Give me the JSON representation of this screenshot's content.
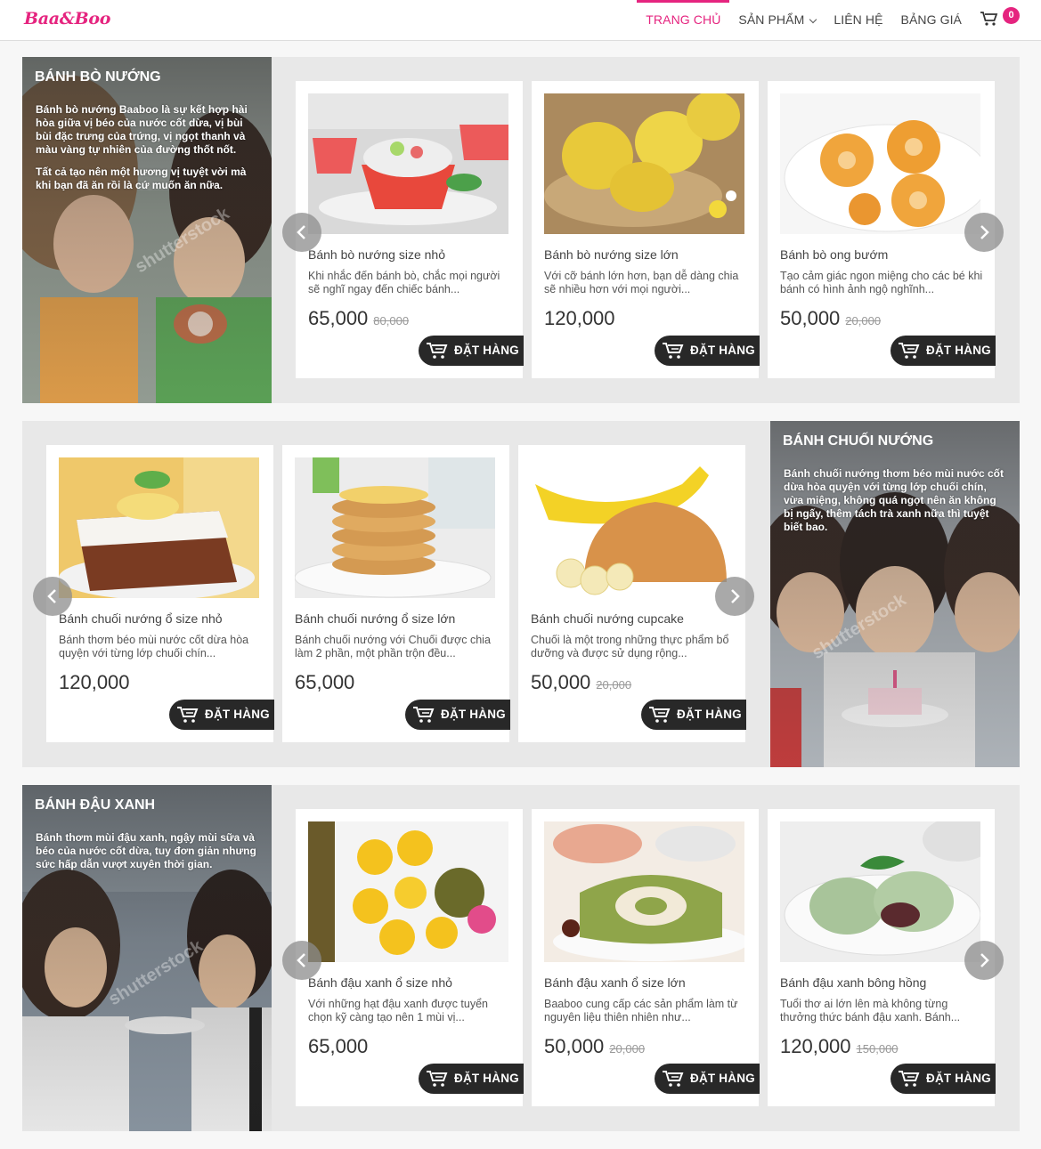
{
  "header": {
    "logo": "Baa&Boo",
    "nav": [
      {
        "label": "TRANG CHỦ",
        "active": true
      },
      {
        "label": "SẢN PHẨM",
        "dropdown": true
      },
      {
        "label": "LIÊN HỆ"
      },
      {
        "label": "BẢNG GIÁ"
      }
    ],
    "cart_count": "0",
    "accent_color": "#e5247f"
  },
  "order_label": "ĐẶT HÀNG",
  "sections": [
    {
      "title": "BÁNH BÒ NƯỚNG",
      "paragraphs": [
        "Bánh bò nướng Baaboo là sự kết hợp hài hòa giữa vị béo của nước cốt dừa, vị bùi bùi đặc trưng của trứng, vị ngọt thanh và màu vàng tự nhiên của đường thốt nốt.",
        "Tất cả tạo nên một hương vị tuyệt vời mà khi bạn đã ăn rồi là cứ muốn ăn nữa."
      ],
      "products": [
        {
          "name": "Bánh bò nướng size nhỏ",
          "desc": "Khi nhắc đến bánh bò, chắc mọi người sẽ nghĩ ngay đến chiếc bánh...",
          "price": "65,000",
          "old_price": "80,000"
        },
        {
          "name": "Bánh bò nướng size lớn",
          "desc": "Với cỡ bánh lớn hơn, bạn dễ dàng chia sẽ nhiều hơn với mọi người...",
          "price": "120,000",
          "old_price": ""
        },
        {
          "name": "Bánh bò ong bướm",
          "desc": "Tạo cảm giác ngon miệng cho các bé khi bánh có hình ảnh ngộ nghĩnh...",
          "price": "50,000",
          "old_price": "20,000"
        }
      ]
    },
    {
      "title": "BÁNH CHUỐI NƯỚNG",
      "paragraphs": [
        "Bánh chuối nướng thơm béo mùi nước cốt dừa hòa quyện với từng lớp chuối chín, vừa miệng, không quá ngọt nên ăn không bị ngấy, thêm tách trà xanh nữa thì tuyệt biết bao."
      ],
      "products": [
        {
          "name": "Bánh chuối nướng ổ size nhỏ",
          "desc": "Bánh thơm béo mùi nước cốt dừa hòa quyện với từng lớp chuối chín...",
          "price": "120,000",
          "old_price": ""
        },
        {
          "name": "Bánh chuối nướng ổ size lớn",
          "desc": "Bánh chuối nướng với Chuối được chia làm 2 phần, một phần trộn đều...",
          "price": "65,000",
          "old_price": ""
        },
        {
          "name": "Bánh chuối nướng cupcake",
          "desc": "Chuối là một trong những thực phẩm bổ dưỡng và được sử dụng rộng...",
          "price": "50,000",
          "old_price": "20,000"
        }
      ]
    },
    {
      "title": "BÁNH ĐẬU XANH",
      "paragraphs": [
        "Bánh thơm mùi đậu xanh, ngậy mùi sữa và béo của nước cốt dừa, tuy đơn giản nhưng sức hấp dẫn vượt xuyên thời gian."
      ],
      "products": [
        {
          "name": "Bánh đậu xanh ổ size nhỏ",
          "desc": "Với những hạt đậu xanh được tuyển chọn kỹ càng tạo nên 1 mùi vị...",
          "price": "65,000",
          "old_price": ""
        },
        {
          "name": "Bánh đậu xanh ổ size lớn",
          "desc": "Baaboo cung cấp các sản phẩm làm từ nguyên liệu thiên nhiên như...",
          "price": "50,000",
          "old_price": "20,000"
        },
        {
          "name": "Bánh đậu xanh bông hồng",
          "desc": "Tuổi thơ ai lớn lên mà không từng thưởng thức bánh đậu xanh. Bánh...",
          "price": "120,000",
          "old_price": "150,000"
        }
      ]
    }
  ],
  "watermark": "shutterstock"
}
